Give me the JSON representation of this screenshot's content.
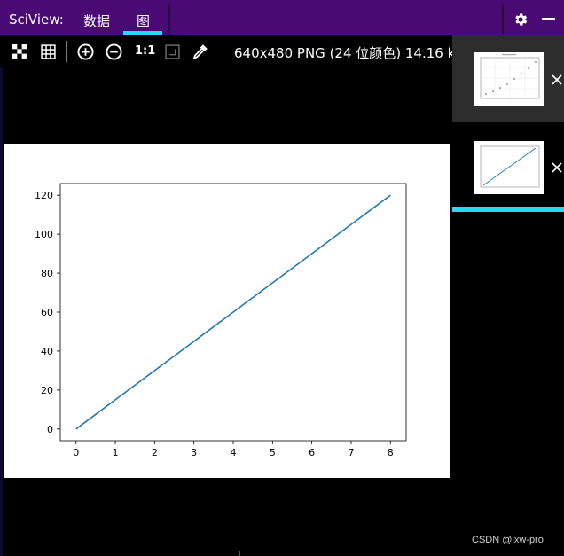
{
  "header": {
    "app_title": "SciView:",
    "tabs": [
      {
        "label": "数据"
      },
      {
        "label": "图"
      }
    ]
  },
  "toolbar": {
    "actual_size_label": "1:1",
    "image_info": "640x480 PNG (24 位颜色) 14.16 kB"
  },
  "colors": {
    "titlebar": "#4a0a73",
    "accent": "#2ad8f0",
    "background": "#000000",
    "plot_line": "#1f77b4"
  },
  "icons": [
    "chessboard-icon",
    "grid-icon",
    "zoom-in-icon",
    "zoom-out-icon",
    "fit-window-icon",
    "color-picker-icon",
    "gear-icon",
    "minimize-icon",
    "close-icon"
  ],
  "chart_data": {
    "type": "line",
    "x": [
      0,
      1,
      2,
      3,
      4,
      5,
      6,
      7,
      8
    ],
    "series": [
      {
        "values": [
          0,
          15,
          30,
          45,
          60,
          75,
          90,
          105,
          120
        ]
      }
    ],
    "xticks": [
      "0",
      "1",
      "2",
      "3",
      "4",
      "5",
      "6",
      "7",
      "8"
    ],
    "yticks": [
      "0",
      "20",
      "40",
      "60",
      "80",
      "100",
      "120"
    ],
    "xlim": [
      -0.4,
      8.4
    ],
    "ylim": [
      -6,
      126
    ],
    "title": "",
    "xlabel": "",
    "ylabel": "",
    "grid": false
  },
  "footer": {
    "watermark": "CSDN @lxw-pro"
  }
}
